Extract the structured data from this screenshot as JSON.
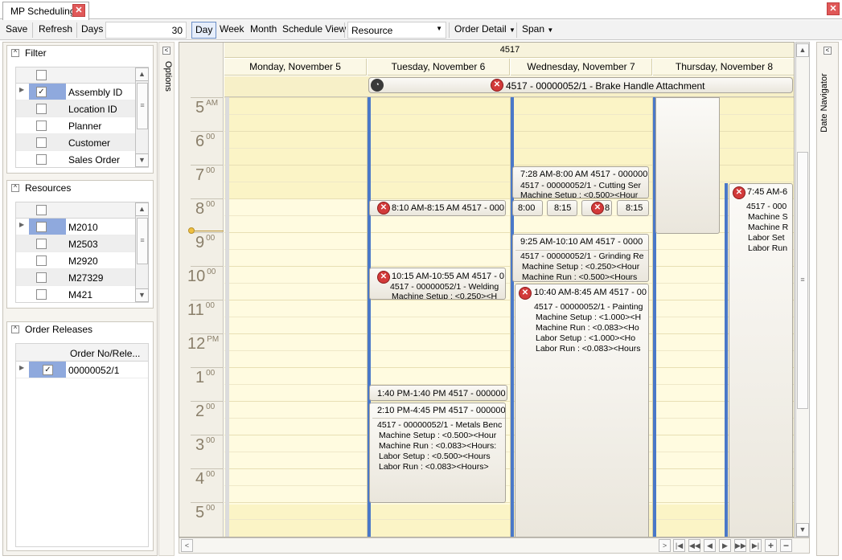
{
  "window": {
    "tab_title": "MP Scheduling"
  },
  "toolbar": {
    "save": "Save",
    "refresh": "Refresh",
    "days_label": "Days",
    "days_value": "30",
    "day": "Day",
    "week": "Week",
    "month": "Month",
    "schedule_view": "Schedule View",
    "group_by": "Resource",
    "order_detail": "Order Detail",
    "span": "Span"
  },
  "options_label": "Options",
  "date_navigator_label": "Date Navigator",
  "filter": {
    "title": "Filter",
    "items": [
      {
        "label": "Assembly ID",
        "checked": true
      },
      {
        "label": "Location ID",
        "checked": false
      },
      {
        "label": "Planner",
        "checked": false
      },
      {
        "label": "Customer",
        "checked": false
      },
      {
        "label": "Sales Order",
        "checked": false
      }
    ]
  },
  "resources": {
    "title": "Resources",
    "items": [
      {
        "label": "M2010",
        "checked": false
      },
      {
        "label": "M2503",
        "checked": false
      },
      {
        "label": "M2920",
        "checked": false
      },
      {
        "label": "M27329",
        "checked": false
      },
      {
        "label": "M421",
        "checked": false
      }
    ]
  },
  "order_releases": {
    "title": "Order Releases",
    "column": "Order No/Rele...",
    "items": [
      {
        "label": "00000052/1",
        "checked": true
      }
    ]
  },
  "schedule": {
    "group_header": "4517",
    "days": [
      "Monday, November 5",
      "Tuesday, November 6",
      "Wednesday, November 7",
      "Thursday, November 8"
    ],
    "allday_event": "4517 - 00000052/1 - Brake Handle Attachment",
    "hours": [
      {
        "h": "5",
        "m": "AM"
      },
      {
        "h": "6",
        "m": "00"
      },
      {
        "h": "7",
        "m": "00"
      },
      {
        "h": "8",
        "m": "00"
      },
      {
        "h": "9",
        "m": "00"
      },
      {
        "h": "10",
        "m": "00"
      },
      {
        "h": "11",
        "m": "00"
      },
      {
        "h": "12",
        "m": "PM"
      },
      {
        "h": "1",
        "m": "00"
      },
      {
        "h": "2",
        "m": "00"
      },
      {
        "h": "3",
        "m": "00"
      },
      {
        "h": "4",
        "m": "00"
      },
      {
        "h": "5",
        "m": "00"
      }
    ],
    "appointments": {
      "a1": {
        "title": "7:28 AM-8:00 AM 4517 - 000000",
        "line1": "4517 - 00000052/1 - Cutting Ser",
        "line2": "Machine Setup : <0.500><Hour"
      },
      "a2": {
        "title": "8:10 AM-8:15 AM 4517 - 000"
      },
      "a3a": {
        "title": "8:00"
      },
      "a3b": {
        "title": "8:15"
      },
      "a3c": {
        "title": "8"
      },
      "a3d": {
        "title": "8:15"
      },
      "a4": {
        "title": "9:25 AM-10:10 AM 4517 - 0000",
        "line1": "4517 - 00000052/1 - Grinding Re",
        "line2": "Machine Setup : <0.250><Hour",
        "line3": "Machine Run : <0.500><Hours"
      },
      "a5": {
        "title": "10:15 AM-10:55 AM 4517 - 0",
        "line1": "4517 - 00000052/1 - Welding",
        "line2": "Machine Setup : <0.250><H"
      },
      "a6": {
        "title": "10:40 AM-8:45 AM 4517 - 00",
        "line1": "4517 - 00000052/1 - Painting",
        "line2": "Machine Setup : <1.000><H",
        "line3": "Machine Run : <0.083><Ho",
        "line4": "Labor Setup : <1.000><Ho",
        "line5": "Labor Run : <0.083><Hours"
      },
      "a7": {
        "title": "1:40 PM-1:40 PM 4517 - 000000"
      },
      "a8": {
        "title": "2:10 PM-4:45 PM 4517 - 000000",
        "line1": "4517 - 00000052/1 - Metals Benc",
        "line2": "Machine Setup : <0.500><Hour",
        "line3": "Machine Run : <0.083><Hours:",
        "line4": "Labor Setup : <0.500><Hours",
        "line5": "Labor Run : <0.083><Hours>"
      },
      "a9": {
        "title": "7:45 AM-6",
        "line1": "4517 - 000",
        "line2": "Machine S",
        "line3": "Machine R",
        "line4": "Labor Set",
        "line5": "Labor Run"
      }
    }
  }
}
